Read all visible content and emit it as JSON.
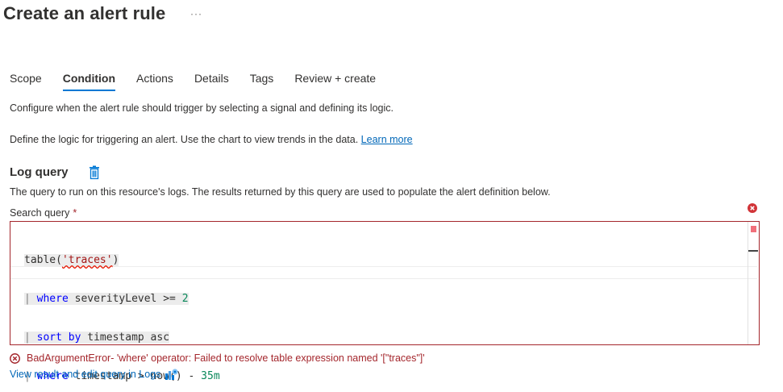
{
  "header": {
    "title": "Create an alert rule",
    "more": "···"
  },
  "tabs": [
    {
      "label": "Scope",
      "active": false
    },
    {
      "label": "Condition",
      "active": true
    },
    {
      "label": "Actions",
      "active": false
    },
    {
      "label": "Details",
      "active": false
    },
    {
      "label": "Tags",
      "active": false
    },
    {
      "label": "Review + create",
      "active": false
    }
  ],
  "intro": {
    "text": "Configure when the alert rule should trigger by selecting a signal and defining its logic.",
    "logic_text": "Define the logic for triggering an alert. Use the chart to view trends in the data.",
    "learn_more": "Learn more"
  },
  "log_query": {
    "title": "Log query",
    "description": "The query to run on this resource's logs. The results returned by this query are used to populate the alert definition below.",
    "field_label": "Search query",
    "required_mark": "*",
    "code": {
      "l1_fn": "table(",
      "l1_str": "'traces'",
      "l1_end": ")",
      "pipe": "|",
      "l2_kw": "where",
      "l2_rest": " severityLevel >= ",
      "l2_num": "2",
      "l3_kw": "sort by",
      "l3_rest": " timestamp asc",
      "l4_kw": "where",
      "l4_rest": " timestamp > now() - ",
      "l4_num": "35m"
    },
    "error": "BadArgumentError- 'where' operator: Failed to resolve table expression named '[\"traces\"]'",
    "logs_link": "View result and edit query in Logs"
  },
  "colors": {
    "accent": "#0078d4",
    "error": "#a4262c",
    "link": "#0067b8"
  }
}
